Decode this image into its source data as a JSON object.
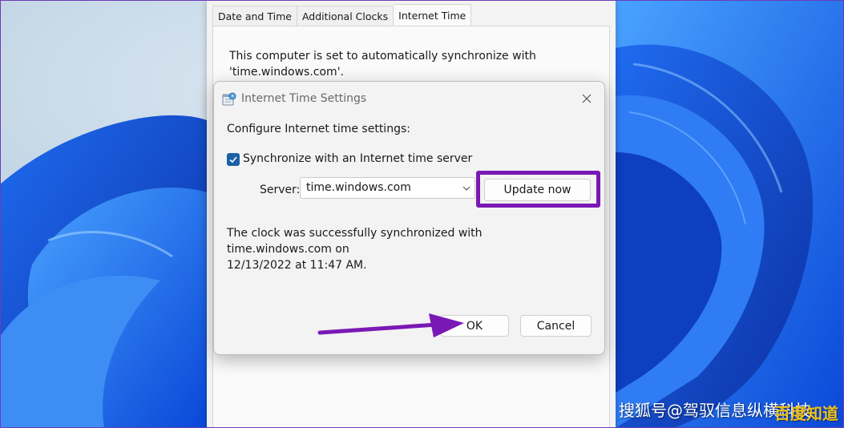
{
  "background_window": {
    "tabs": [
      {
        "label": "Date and Time",
        "active": false
      },
      {
        "label": "Additional Clocks",
        "active": false
      },
      {
        "label": "Internet Time",
        "active": true
      }
    ],
    "sync_message_line1": "This computer is set to automatically synchronize with",
    "sync_message_line2": "'time.windows.com'."
  },
  "dialog": {
    "title": "Internet Time Settings",
    "configure_label": "Configure Internet time settings:",
    "sync_checkbox_label": "Synchronize with an Internet time server",
    "sync_checked": true,
    "server_label": "Server:",
    "server_value": "time.windows.com",
    "update_button": "Update now",
    "status_line1": "The clock was successfully synchronized with time.windows.com on",
    "status_line2": "12/13/2022 at 11:47 AM.",
    "ok_button": "OK",
    "cancel_button": "Cancel"
  },
  "annotations": {
    "highlight_color": "#7a18b5",
    "arrow_color": "#7a18b5"
  },
  "watermark": {
    "text": "搜狐号@驾驭信息纵横科技",
    "logo_text": "百度知道"
  },
  "icons": [
    "internet-time-icon",
    "close-icon",
    "checkmark-icon",
    "chevron-down-icon",
    "pointer-arrow-icon"
  ]
}
